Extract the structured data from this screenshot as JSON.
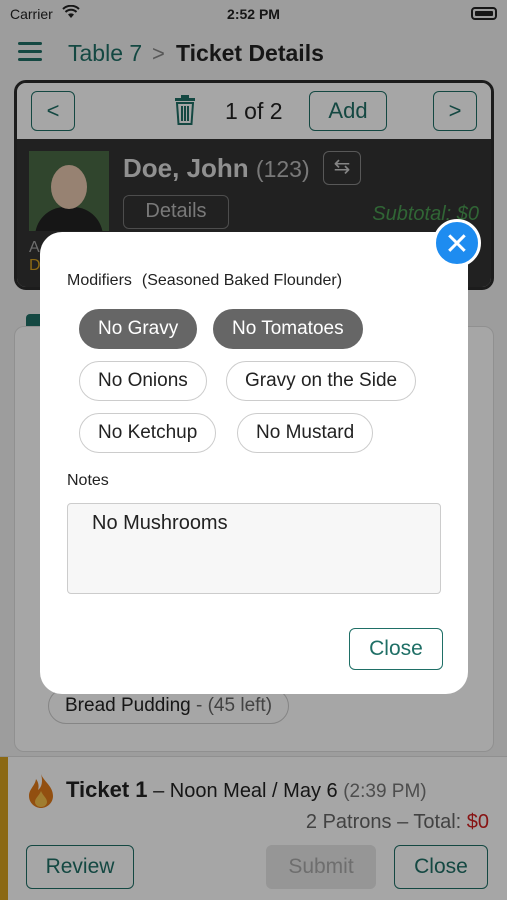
{
  "status_bar": {
    "carrier": "Carrier",
    "time": "2:52 PM"
  },
  "nav": {
    "breadcrumb": "Table 7",
    "separator": ">",
    "title": "Ticket Details"
  },
  "ticket_card": {
    "prev": "<",
    "next": ">",
    "page_indicator": "1 of 2",
    "add_label": "Add",
    "patron_name": "Doe, John",
    "patron_id": "(123)",
    "details_label": "Details",
    "subtotal": "Subtotal: $0",
    "allergy_flag": "A",
    "diet_flag": "D"
  },
  "menu_list": {
    "item_name": "Bread Pudding",
    "item_remaining": " - (45 left)"
  },
  "ticket_bar": {
    "ticket_label": "Ticket 1",
    "meal": " – Noon Meal / May 6 ",
    "time": "(2:39 PM)",
    "patrons_total": "2 Patrons – Total: ",
    "total_value": "$0",
    "review_label": "Review",
    "submit_label": "Submit",
    "close_label": "Close"
  },
  "modal": {
    "modifiers_label": "Modifiers",
    "item_label": "(Seasoned Baked Flounder)",
    "modifiers": [
      {
        "label": "No Gravy",
        "selected": true
      },
      {
        "label": "No Tomatoes",
        "selected": true
      },
      {
        "label": "No Onions",
        "selected": false
      },
      {
        "label": "Gravy on the Side",
        "selected": false
      },
      {
        "label": "No Ketchup",
        "selected": false
      },
      {
        "label": "No Mustard",
        "selected": false
      }
    ],
    "notes_label": "Notes",
    "notes_value": "No Mushrooms",
    "close_label": "Close",
    "dismiss_icon": "close-icon"
  },
  "colors": {
    "accent": "#1f6f66",
    "dismiss": "#1e8cf0",
    "warning": "#d6a21f",
    "total": "#d02020"
  }
}
